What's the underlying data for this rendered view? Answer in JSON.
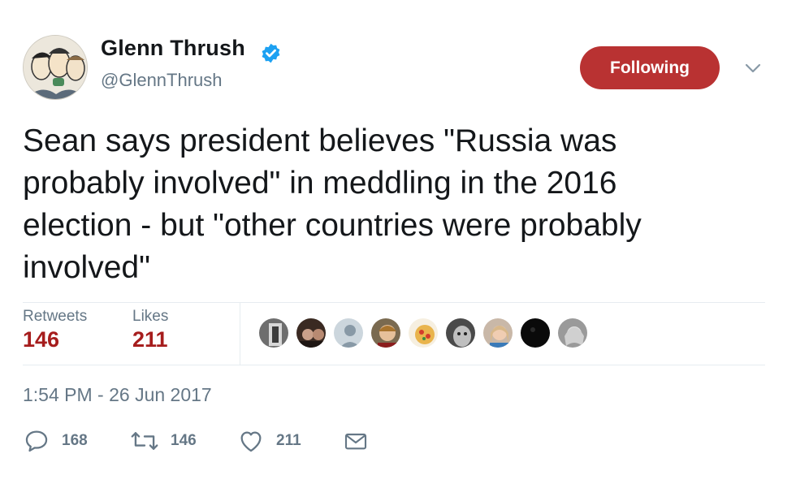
{
  "author": {
    "name": "Glenn Thrush",
    "handle": "@GlennThrush",
    "avatar_icon": "cartoon-avatar-icon",
    "verified_icon": "verified-badge-icon"
  },
  "follow_button": {
    "label": "Following",
    "color": "#b93232"
  },
  "menu_icon": "chevron-down-icon",
  "tweet": {
    "lines": [
      "Sean says president believes \"Russia was",
      "probably involved\" in meddling in the 2016",
      "election - but \"other countries were probably",
      "involved\""
    ]
  },
  "stats": {
    "retweets_label": "Retweets",
    "retweets_count": "146",
    "likes_label": "Likes",
    "likes_count": "211"
  },
  "likers": [
    "liker-avatar-1",
    "liker-avatar-2",
    "liker-avatar-3",
    "liker-avatar-4",
    "liker-avatar-5",
    "liker-avatar-6",
    "liker-avatar-7",
    "liker-avatar-8",
    "liker-avatar-9"
  ],
  "timestamp": "1:54 PM - 26 Jun 2017",
  "actions": {
    "reply_count": "168",
    "retweet_count": "146",
    "like_count": "211",
    "reply_icon": "reply-icon",
    "retweet_icon": "retweet-icon",
    "like_icon": "heart-icon",
    "message_icon": "envelope-icon"
  }
}
